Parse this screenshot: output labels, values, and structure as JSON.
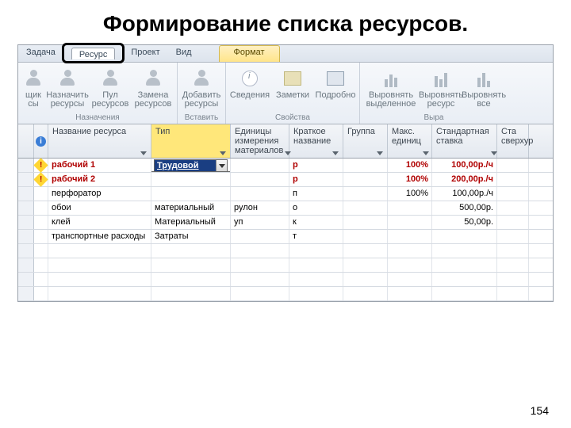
{
  "slide_title": "Формирование списка ресурсов.",
  "page_number": "154",
  "tabs": {
    "task": "Задача",
    "resource": "Ресурс",
    "project": "Проект",
    "view": "Вид",
    "format": "Формат"
  },
  "ribbon": {
    "partial_btn": "щик\nсы",
    "assign": "Назначить ресурсы",
    "pool": "Пул ресурсов",
    "replace": "Замена ресурсов",
    "group_assign": "Назначения",
    "add": "Добавить ресурсы",
    "group_insert": "Вставить",
    "info": "Сведения",
    "notes": "Заметки",
    "details": "Подробно",
    "group_props": "Свойства",
    "level_sel": "Выровнять выделенное",
    "level_res": "Выровнять ресурс",
    "level_all": "Выровнять все",
    "group_level": "Выра"
  },
  "columns": {
    "name": "Название ресурса",
    "type": "Тип",
    "unit": "Единицы измерения материалов",
    "short": "Краткое название",
    "group": "Группа",
    "max": "Макс. единиц",
    "rate": "Стандартная ставка",
    "over": "Ста\nсверхур"
  },
  "type_dropdown": {
    "selected": "Трудовой",
    "options": [
      "Трудовой",
      "Материальный",
      "Затраты"
    ]
  },
  "rows": [
    {
      "warn": true,
      "red": true,
      "name": "рабочий 1",
      "type_select": true,
      "unit": "",
      "short": "р",
      "group": "",
      "max": "100%",
      "rate": "100,00р./ч"
    },
    {
      "warn": true,
      "red": true,
      "name": "рабочий 2",
      "type": "",
      "unit": "",
      "short": "р",
      "group": "",
      "max": "100%",
      "rate": "200,00р./ч"
    },
    {
      "warn": false,
      "red": false,
      "name": "перфоратор",
      "type": "",
      "unit": "",
      "short": "п",
      "group": "",
      "max": "100%",
      "rate": "100,00р./ч"
    },
    {
      "warn": false,
      "red": false,
      "name": "обои",
      "type": "материальный",
      "unit": "рулон",
      "short": "о",
      "group": "",
      "max": "",
      "rate": "500,00р."
    },
    {
      "warn": false,
      "red": false,
      "name": "клей",
      "type": "Материальный",
      "unit": "уп",
      "short": "к",
      "group": "",
      "max": "",
      "rate": "50,00р."
    },
    {
      "warn": false,
      "red": false,
      "name": "транспортные расходы",
      "type": "Затраты",
      "unit": "",
      "short": "т",
      "group": "",
      "max": "",
      "rate": ""
    }
  ]
}
